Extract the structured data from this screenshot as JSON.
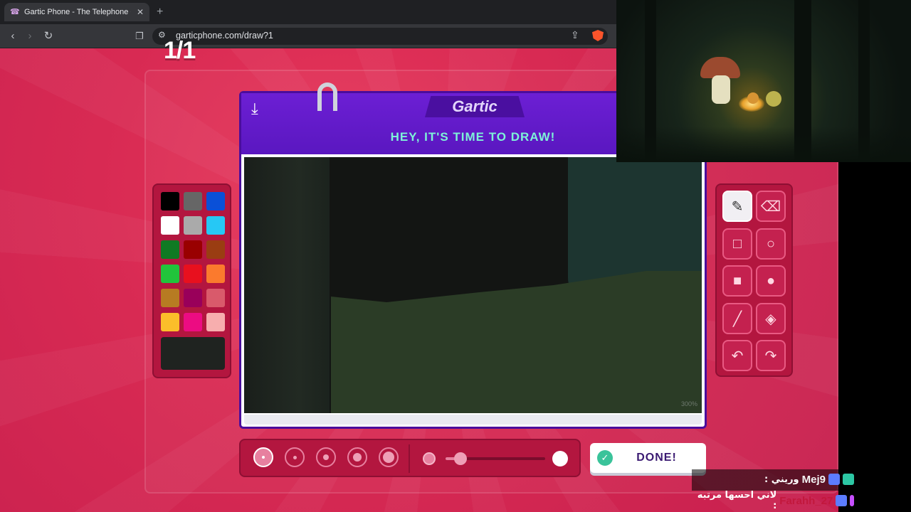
{
  "browser": {
    "tab_title": "Gartic Phone - The Telephone Ga",
    "url": "garticphone.com/draw?1"
  },
  "game": {
    "round_counter": "1/1",
    "logo": "Gartic",
    "prompt": "HEY, IT'S TIME TO DRAW!",
    "zoom_label": "300%",
    "done_label": "DONE!",
    "current_color": "#1f2320",
    "palette": [
      "#000000",
      "#666666",
      "#0a50d8",
      "#ffffff",
      "#aaaaaa",
      "#26c8f5",
      "#0f7a23",
      "#990000",
      "#9a3d12",
      "#21c43b",
      "#e8101e",
      "#fb7a2d",
      "#b77b22",
      "#99005a",
      "#d95a6b",
      "#fbbe2a",
      "#ec0c82",
      "#f7aeae"
    ],
    "active_tool": "pencil",
    "brush_size_index": 0,
    "opacity_fraction": 0.15
  },
  "chat": {
    "line1": {
      "user": "Mej9",
      "message": "وريني :"
    },
    "line2": {
      "user": "Farahh_27",
      "message": "لاني احسها مرتبه :"
    }
  },
  "colors": {
    "accent": "#d82a53",
    "board_purple": "#6c1fd4",
    "prompt_text": "#7ef3d8"
  }
}
